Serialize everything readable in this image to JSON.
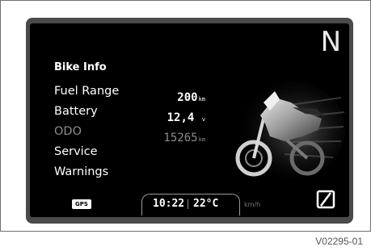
{
  "display": {
    "gear": "N",
    "menu_title": "Bike Info",
    "menu_items": [
      {
        "label": "Fuel Range",
        "value": "200",
        "unit": "km"
      },
      {
        "label": "Battery",
        "value": "12,4",
        "unit": "v"
      },
      {
        "label": "ODO",
        "value": "15265",
        "unit": "km"
      },
      {
        "label": "Service"
      },
      {
        "label": "Warnings"
      }
    ],
    "gps_label": "GPS",
    "time": "10:22",
    "temperature": "22°C",
    "speed_unit": "km/h"
  },
  "icons": {
    "bike": "motorcycle-image",
    "mode": "zero-slash-icon"
  },
  "caption": "V02295-01",
  "colors": {
    "screen_bg": "#000000",
    "bezel": "#4a4a4a",
    "text_active": "#ffffff",
    "text_dim": "#8c8c8c"
  }
}
